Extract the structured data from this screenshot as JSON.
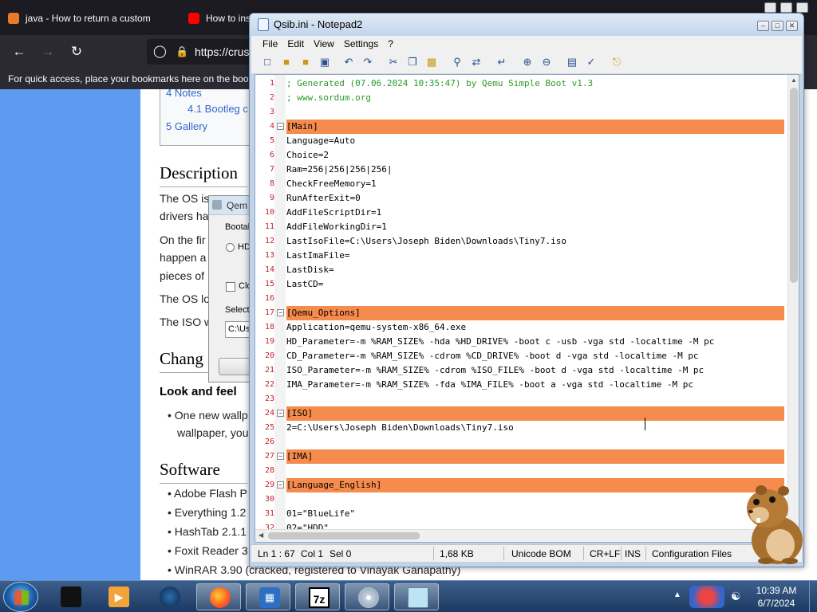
{
  "browser": {
    "tabs": [
      {
        "label": "java - How to return a custom",
        "icon": "java-icon"
      },
      {
        "label": "How to ins",
        "icon": "youtube-icon"
      }
    ],
    "url": "https://crus",
    "bookmark_hint": "For quick access, place your bookmarks here on the book",
    "page": {
      "toc_items": [
        {
          "label": "4  Notes"
        },
        {
          "label": "4.1  Bootleg c"
        },
        {
          "label": "5  Gallery"
        }
      ],
      "headings": {
        "description": "Description",
        "changes": "Chang",
        "look_and_feel": "Look and feel",
        "software": "Software"
      },
      "para1a": "The OS is",
      "para1b": "drivers ha",
      "para2a": "On the fir",
      "para2b": "happen a",
      "para2c": "pieces of",
      "para3": "The OS lo",
      "para4": "The ISO w",
      "bullet1a": "One new wallp",
      "bullet1b": "wallpaper, you",
      "software_items": [
        {
          "label": "Adobe Flash P"
        },
        {
          "label": "Everything 1.2"
        },
        {
          "label": "HashTab 2.1.1"
        },
        {
          "label": "Foxit Reader 3"
        },
        {
          "label": "WinRAR 3.90 (cracked, registered to Vinayak Ganapathy)"
        }
      ]
    },
    "qemu_dialog": {
      "title": "Qem",
      "boot_label": "Bootab",
      "hd_label": "HD",
      "check_label": "Clo",
      "select_label": "Select",
      "path": "C:\\Us"
    }
  },
  "notepad": {
    "title": "Qsib.ini - Notepad2",
    "menu": [
      "File",
      "Edit",
      "View",
      "Settings",
      "?"
    ],
    "lines": [
      {
        "n": "1",
        "text": "; Generated (07.06.2024 10:35:47) by Qemu Simple Boot v1.3",
        "kind": "cmt"
      },
      {
        "n": "2",
        "text": "; www.sordum.org",
        "kind": "cmt"
      },
      {
        "n": "3",
        "text": "",
        "kind": ""
      },
      {
        "n": "4",
        "text": "[Main]",
        "kind": "sec"
      },
      {
        "n": "5",
        "text": "Language=Auto",
        "kind": ""
      },
      {
        "n": "6",
        "text": "Choice=2",
        "kind": ""
      },
      {
        "n": "7",
        "text": "Ram=256|256|256|256|",
        "kind": ""
      },
      {
        "n": "8",
        "text": "CheckFreeMemory=1",
        "kind": ""
      },
      {
        "n": "9",
        "text": "RunAfterExit=0",
        "kind": ""
      },
      {
        "n": "10",
        "text": "AddFileScriptDir=1",
        "kind": ""
      },
      {
        "n": "11",
        "text": "AddFileWorkingDir=1",
        "kind": ""
      },
      {
        "n": "12",
        "text": "LastIsoFile=C:\\Users\\Joseph Biden\\Downloads\\Tiny7.iso",
        "kind": ""
      },
      {
        "n": "13",
        "text": "LastImaFile=",
        "kind": ""
      },
      {
        "n": "14",
        "text": "LastDisk=",
        "kind": ""
      },
      {
        "n": "15",
        "text": "LastCD=",
        "kind": ""
      },
      {
        "n": "16",
        "text": "",
        "kind": ""
      },
      {
        "n": "17",
        "text": "[Qemu_Options]",
        "kind": "sec"
      },
      {
        "n": "18",
        "text": "Application=qemu-system-x86_64.exe",
        "kind": ""
      },
      {
        "n": "19",
        "text": "HD_Parameter=-m %RAM_SIZE% -hda %HD_DRIVE% -boot c -usb -vga std -localtime -M pc",
        "kind": ""
      },
      {
        "n": "20",
        "text": "CD_Parameter=-m %RAM_SIZE% -cdrom %CD_DRIVE% -boot d -vga std -localtime -M pc",
        "kind": ""
      },
      {
        "n": "21",
        "text": "ISO_Parameter=-m %RAM_SIZE% -cdrom %ISO_FILE% -boot d -vga std -localtime -M pc",
        "kind": ""
      },
      {
        "n": "22",
        "text": "IMA_Parameter=-m %RAM_SIZE% -fda %IMA_FILE% -boot a -vga std -localtime -M pc",
        "kind": ""
      },
      {
        "n": "23",
        "text": "",
        "kind": ""
      },
      {
        "n": "24",
        "text": "[ISO]",
        "kind": "sec"
      },
      {
        "n": "25",
        "text": "2=C:\\Users\\Joseph Biden\\Downloads\\Tiny7.iso",
        "kind": ""
      },
      {
        "n": "26",
        "text": "",
        "kind": ""
      },
      {
        "n": "27",
        "text": "[IMA]",
        "kind": "sec"
      },
      {
        "n": "28",
        "text": "",
        "kind": ""
      },
      {
        "n": "29",
        "text": "[Language_English]",
        "kind": "sec"
      },
      {
        "n": "30",
        "text": "",
        "kind": ""
      },
      {
        "n": "31",
        "text": "01=\"BlueLife\"",
        "kind": ""
      },
      {
        "n": "32",
        "text": "02=\"HDD\"",
        "kind": ""
      }
    ],
    "status": {
      "position": "Ln 1 : 67",
      "col": "Col 1",
      "sel": "Sel 0",
      "size": "1,68 KB",
      "encoding": "Unicode BOM",
      "eol": "CR+LF",
      "mode": "INS",
      "scheme": "Configuration Files"
    },
    "section_color": "#f58b4c",
    "comment_color": "#2b9a2b"
  },
  "taskbar": {
    "time": "10:39 AM",
    "date": "6/7/2024",
    "items": [
      {
        "name": "taskbar-app-1",
        "icon": "black-device-icon"
      },
      {
        "name": "taskbar-app-2",
        "icon": "media-player-icon"
      },
      {
        "name": "taskbar-app-3",
        "icon": "globe-icon"
      },
      {
        "name": "taskbar-firefox",
        "icon": "firefox-icon"
      },
      {
        "name": "taskbar-virtualbox",
        "icon": "virtualbox-icon"
      },
      {
        "name": "taskbar-7zip",
        "icon": "7zip-icon"
      },
      {
        "name": "taskbar-disc",
        "icon": "disc-icon"
      },
      {
        "name": "taskbar-notepad2",
        "icon": "notepad-icon"
      }
    ]
  }
}
